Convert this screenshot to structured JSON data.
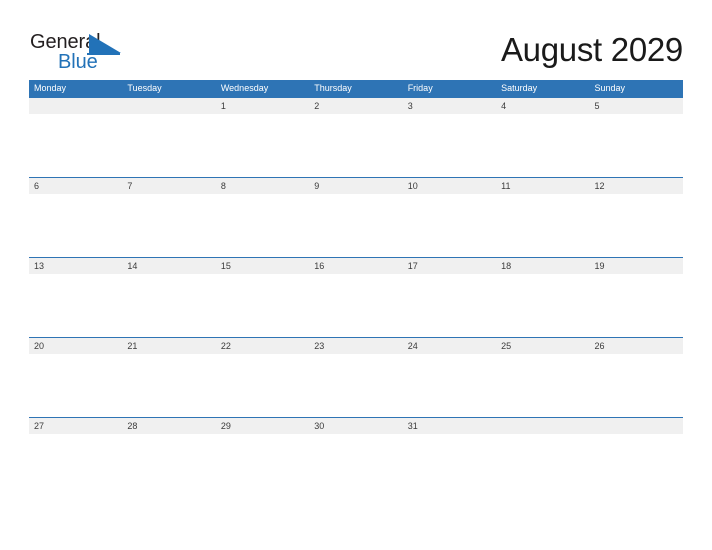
{
  "brand": {
    "logo_name": "general-blue-logo",
    "word_top": "General",
    "word_bottom": "Blue",
    "accent_color": "#2272b8",
    "text_color": "#231f20"
  },
  "header": {
    "title": "August 2029",
    "month": "August",
    "year": "2029"
  },
  "calendar": {
    "header_bg": "#2e74b5",
    "band_bg": "#f0f0f0",
    "weekdays": [
      "Monday",
      "Tuesday",
      "Wednesday",
      "Thursday",
      "Friday",
      "Saturday",
      "Sunday"
    ],
    "weeks": [
      [
        "",
        "",
        "1",
        "2",
        "3",
        "4",
        "5"
      ],
      [
        "6",
        "7",
        "8",
        "9",
        "10",
        "11",
        "12"
      ],
      [
        "13",
        "14",
        "15",
        "16",
        "17",
        "18",
        "19"
      ],
      [
        "20",
        "21",
        "22",
        "23",
        "24",
        "25",
        "26"
      ],
      [
        "27",
        "28",
        "29",
        "30",
        "31",
        "",
        ""
      ]
    ]
  }
}
